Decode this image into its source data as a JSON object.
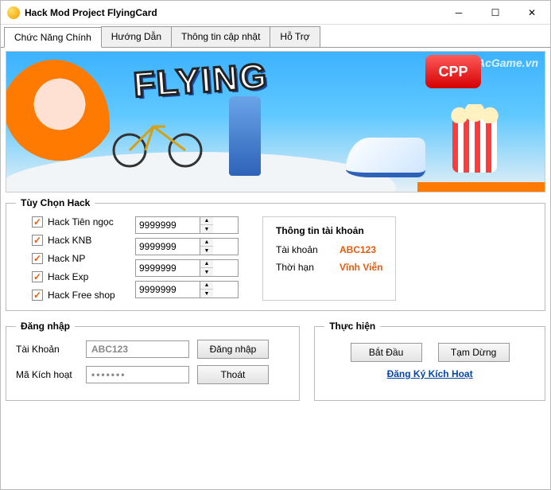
{
  "window": {
    "title": "Hack Mod Project FlyingCard"
  },
  "tabs": [
    "Chức Năng Chính",
    "Hướng Dẫn",
    "Thông tin cập nhật",
    "Hỗ Trợ"
  ],
  "banner": {
    "logo": "FLYING",
    "badge": "CPP",
    "watermark": "ShopAcGame.vn"
  },
  "hack": {
    "legend": "Tùy Chọn Hack",
    "options": [
      "Hack Tiên ngọc",
      "Hack KNB",
      "Hack NP",
      "Hack Exp",
      "Hack Free shop"
    ],
    "values": [
      "9999999",
      "9999999",
      "9999999",
      "9999999"
    ]
  },
  "account": {
    "title": "Thông tin tài khoản",
    "acc_label": "Tài khoản",
    "acc_value": "ABC123",
    "exp_label": "Thời hạn",
    "exp_value": "Vĩnh Viễn"
  },
  "login": {
    "legend": "Đăng nhập",
    "user_label": "Tài Khoản",
    "user_value": "ABC123",
    "key_label": "Mã Kích hoạt",
    "key_value": "•••••••",
    "btn_login": "Đăng nhập",
    "btn_exit": "Thoát"
  },
  "exec": {
    "legend": "Thực hiện",
    "btn_start": "Bắt Đầu",
    "btn_pause": "Tạm Dừng",
    "register_link": "Đăng Ký Kích Hoạt"
  }
}
